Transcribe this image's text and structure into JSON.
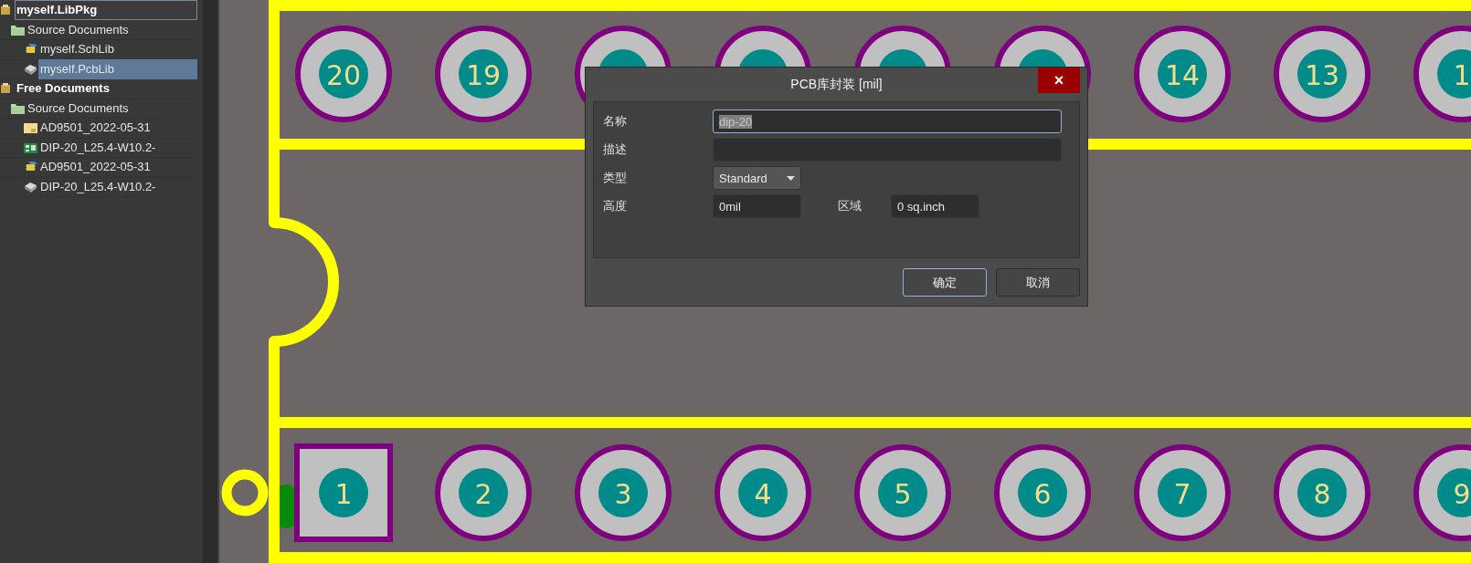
{
  "project_tree": [
    {
      "label": "myself.LibPkg",
      "kind": "project",
      "selected": false,
      "focused": true,
      "children": [
        {
          "label": "Source Documents",
          "kind": "folder",
          "selected": false,
          "focused": false,
          "children": [
            {
              "label": "myself.SchLib",
              "kind": "schlib",
              "selected": false,
              "focused": false
            },
            {
              "label": "myself.PcbLib",
              "kind": "pcblib",
              "selected": true,
              "focused": false
            }
          ]
        }
      ]
    },
    {
      "label": "Free Documents",
      "kind": "project",
      "selected": false,
      "focused": false,
      "children": [
        {
          "label": "Source Documents",
          "kind": "folder",
          "selected": false,
          "focused": false,
          "children": [
            {
              "label": "AD9501_2022-05-31",
              "kind": "document",
              "selected": false,
              "focused": false
            },
            {
              "label": "DIP-20_L25.4-W10.2-",
              "kind": "pcb",
              "selected": false,
              "focused": false
            },
            {
              "label": "AD9501_2022-05-31",
              "kind": "schlib",
              "selected": false,
              "focused": false
            },
            {
              "label": "DIP-20_L25.4-W10.2-",
              "kind": "pcblib",
              "selected": false,
              "focused": false
            }
          ]
        }
      ]
    }
  ],
  "footprint": {
    "top_pads": [
      {
        "label": "20",
        "kind": "round"
      },
      {
        "label": "19",
        "kind": "round"
      },
      {
        "kind": "round"
      },
      {
        "kind": "round"
      },
      {
        "kind": "round"
      },
      {
        "kind": "round"
      },
      {
        "label": "14",
        "kind": "round"
      },
      {
        "label": "13",
        "kind": "round"
      },
      {
        "label": "1",
        "kind": "round"
      }
    ],
    "bottom_pads": [
      {
        "label": "1",
        "kind": "square"
      },
      {
        "label": "2",
        "kind": "round"
      },
      {
        "label": "3",
        "kind": "round"
      },
      {
        "label": "4",
        "kind": "round"
      },
      {
        "label": "5",
        "kind": "round"
      },
      {
        "label": "6",
        "kind": "round"
      },
      {
        "label": "7",
        "kind": "round"
      },
      {
        "label": "8",
        "kind": "round"
      },
      {
        "label": "9",
        "kind": "round"
      }
    ]
  },
  "dialog": {
    "title": "PCB库封装 [mil]",
    "close": "×",
    "rows": [
      [
        {
          "label": "名称",
          "value": "dip-20",
          "kind": "text",
          "focused": true
        }
      ],
      [
        {
          "label": "描述",
          "kind": "text",
          "focused": false
        }
      ],
      [
        {
          "label": "类型",
          "value": "Standard",
          "kind": "dropdown",
          "focused": false
        }
      ],
      [
        {
          "label": "高度",
          "value": "0mil",
          "kind": "text",
          "focused": false
        },
        {
          "label": "区域",
          "value": "0 sq.inch",
          "kind": "text",
          "focused": false
        }
      ]
    ],
    "buttons": [
      {
        "label": "确定",
        "default": true
      },
      {
        "label": "取消",
        "default": false
      }
    ]
  }
}
